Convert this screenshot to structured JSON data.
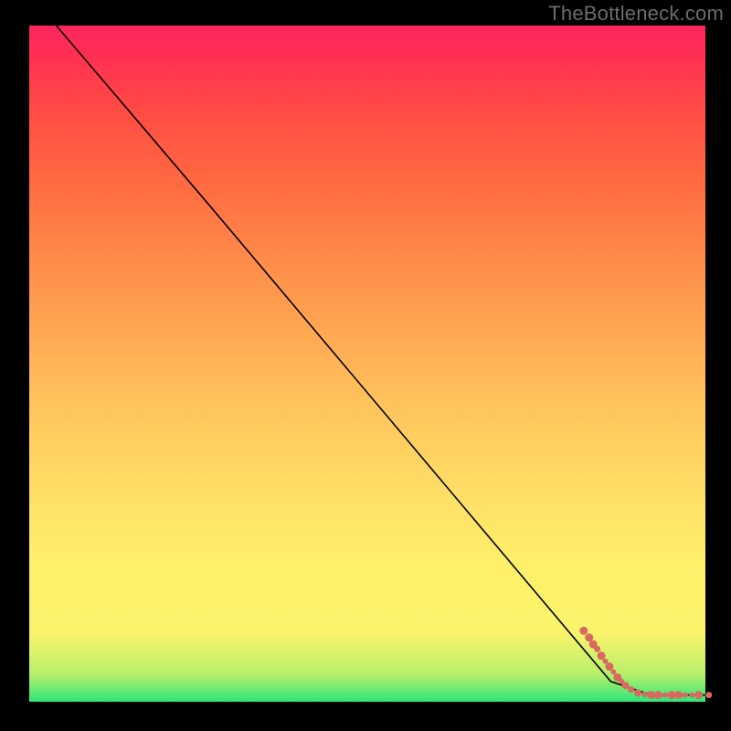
{
  "watermark": "TheBottleneck.com",
  "chart_data": {
    "type": "line",
    "title": "",
    "xlabel": "",
    "ylabel": "",
    "xlim": [
      0,
      100
    ],
    "ylim": [
      0,
      100
    ],
    "line": {
      "name": "curve",
      "points": [
        {
          "x": 4,
          "y": 100
        },
        {
          "x": 27,
          "y": 73
        },
        {
          "x": 86,
          "y": 3
        },
        {
          "x": 92,
          "y": 1
        },
        {
          "x": 100,
          "y": 1
        }
      ]
    },
    "scatter": {
      "name": "points",
      "color": "#d96a61",
      "points": [
        {
          "x": 82.0,
          "y": 10.5,
          "r": 4.5
        },
        {
          "x": 82.8,
          "y": 9.5,
          "r": 4.5
        },
        {
          "x": 83.4,
          "y": 8.5,
          "r": 4.5
        },
        {
          "x": 84.0,
          "y": 7.8,
          "r": 3.5
        },
        {
          "x": 84.6,
          "y": 6.8,
          "r": 4.5
        },
        {
          "x": 85.2,
          "y": 6.0,
          "r": 3.0
        },
        {
          "x": 85.8,
          "y": 5.2,
          "r": 4.5
        },
        {
          "x": 86.4,
          "y": 4.4,
          "r": 3.0
        },
        {
          "x": 87.0,
          "y": 3.6,
          "r": 4.5
        },
        {
          "x": 87.6,
          "y": 3.0,
          "r": 3.0
        },
        {
          "x": 88.2,
          "y": 2.4,
          "r": 4.0
        },
        {
          "x": 89.0,
          "y": 1.8,
          "r": 3.5
        },
        {
          "x": 90.0,
          "y": 1.3,
          "r": 4.0
        },
        {
          "x": 91.0,
          "y": 1.1,
          "r": 3.0
        },
        {
          "x": 92.0,
          "y": 1.0,
          "r": 4.5
        },
        {
          "x": 93.0,
          "y": 1.0,
          "r": 4.5
        },
        {
          "x": 94.0,
          "y": 1.0,
          "r": 3.0
        },
        {
          "x": 95.0,
          "y": 1.0,
          "r": 4.5
        },
        {
          "x": 96.0,
          "y": 1.0,
          "r": 4.5
        },
        {
          "x": 97.0,
          "y": 1.0,
          "r": 3.0
        },
        {
          "x": 98.0,
          "y": 1.0,
          "r": 3.0
        },
        {
          "x": 99.0,
          "y": 1.0,
          "r": 4.5
        },
        {
          "x": 100.5,
          "y": 1.0,
          "r": 3.5
        }
      ]
    },
    "background_gradient": {
      "stops": [
        {
          "pos": 0.0,
          "color": "#2de57a"
        },
        {
          "pos": 0.04,
          "color": "#b7ef6b"
        },
        {
          "pos": 0.1,
          "color": "#f9f46b"
        },
        {
          "pos": 0.2,
          "color": "#fff06a"
        },
        {
          "pos": 0.3,
          "color": "#ffe067"
        },
        {
          "pos": 0.42,
          "color": "#ffc85e"
        },
        {
          "pos": 0.55,
          "color": "#ffa752"
        },
        {
          "pos": 0.67,
          "color": "#ff8748"
        },
        {
          "pos": 0.78,
          "color": "#ff6641"
        },
        {
          "pos": 0.88,
          "color": "#ff4945"
        },
        {
          "pos": 0.96,
          "color": "#ff2e55"
        },
        {
          "pos": 1.0,
          "color": "#ff265f"
        }
      ]
    }
  }
}
